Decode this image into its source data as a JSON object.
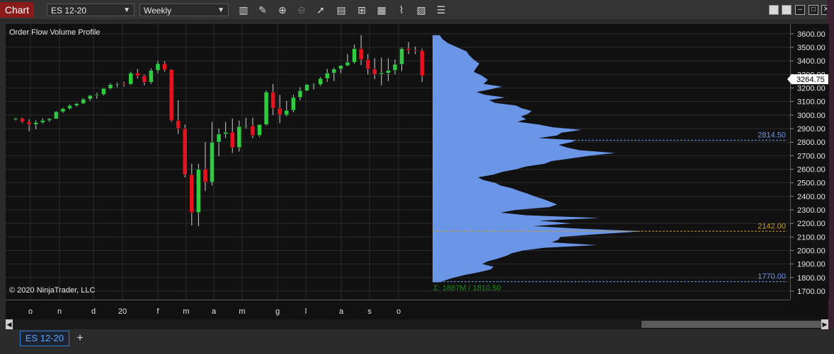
{
  "toolbar": {
    "chart_label": "Chart",
    "instrument": "ES 12-20",
    "interval": "Weekly",
    "icons": [
      "bar-type-icon",
      "drawing-pencil-icon",
      "zoom-in-icon",
      "zoom-out-icon",
      "pointer-icon",
      "data-box-icon",
      "indicators-icon",
      "strategies-icon",
      "templates-icon",
      "properties-icon",
      "more-icon"
    ]
  },
  "panel": {
    "indicator_label": "Order Flow Volume Profile",
    "copyright": "© 2020 NinjaTrader, LLC",
    "profile_summary": "Σ: 1887M / 1810.50"
  },
  "tabs": {
    "active": "ES 12-20",
    "add": "+"
  },
  "colors": {
    "up": "#2ecc40",
    "down": "#e8121f",
    "profile": "#6b96e8",
    "poc": "#c79a2a",
    "value_area": "#6b96e8",
    "current_price_bg": "#ffffff"
  },
  "chart_data": {
    "type": "candlestick",
    "y_range": [
      1650,
      3620
    ],
    "y_ticks": [
      "3600.00",
      "3500.00",
      "3400.00",
      "3300.00",
      "3200.00",
      "3100.00",
      "3000.00",
      "2900.00",
      "2800.00",
      "2700.00",
      "2600.00",
      "2500.00",
      "2400.00",
      "2300.00",
      "2200.00",
      "2100.00",
      "2000.00",
      "1900.00",
      "1800.00",
      "1700.00"
    ],
    "x_labels": [
      "o",
      "n",
      "d",
      "20",
      "f",
      "m",
      "a",
      "m",
      "g",
      "l",
      "a",
      "s",
      "o"
    ],
    "current_price": "3264.75",
    "levels": [
      {
        "name": "value-area-high",
        "label": "2814.50",
        "value": 2814.5
      },
      {
        "name": "poc",
        "label": "2142.00",
        "value": 2142.0
      },
      {
        "name": "value-area-low",
        "label": "1770.00",
        "value": 1770.0
      }
    ],
    "candles": [
      [
        2968,
        2980,
        2960,
        2976
      ],
      [
        2976,
        2982,
        2940,
        2950
      ],
      [
        2950,
        2970,
        2880,
        2930
      ],
      [
        2930,
        2960,
        2895,
        2945
      ],
      [
        2945,
        2975,
        2935,
        2960
      ],
      [
        2960,
        2978,
        2950,
        2972
      ],
      [
        2972,
        3030,
        2970,
        3025
      ],
      [
        3025,
        3055,
        3015,
        3048
      ],
      [
        3048,
        3078,
        3040,
        3070
      ],
      [
        3070,
        3090,
        3060,
        3085
      ],
      [
        3085,
        3125,
        3080,
        3118
      ],
      [
        3118,
        3150,
        3105,
        3145
      ],
      [
        3145,
        3165,
        3120,
        3152
      ],
      [
        3152,
        3200,
        3145,
        3196
      ],
      [
        3196,
        3235,
        3188,
        3225
      ],
      [
        3225,
        3240,
        3205,
        3230
      ],
      [
        3230,
        3245,
        3210,
        3228
      ],
      [
        3228,
        3320,
        3222,
        3310
      ],
      [
        3310,
        3340,
        3270,
        3290
      ],
      [
        3290,
        3300,
        3220,
        3242
      ],
      [
        3242,
        3345,
        3230,
        3330
      ],
      [
        3330,
        3400,
        3310,
        3380
      ],
      [
        3380,
        3398,
        3320,
        3335
      ],
      [
        3335,
        3340,
        2950,
        2960
      ],
      [
        2960,
        3110,
        2860,
        2900
      ],
      [
        2900,
        2930,
        2540,
        2560
      ],
      [
        2560,
        2640,
        2185,
        2280
      ],
      [
        2280,
        2640,
        2180,
        2600
      ],
      [
        2600,
        2800,
        2440,
        2505
      ],
      [
        2505,
        2950,
        2480,
        2800
      ],
      [
        2800,
        2900,
        2695,
        2860
      ],
      [
        2860,
        2950,
        2830,
        2873
      ],
      [
        2873,
        2975,
        2720,
        2760
      ],
      [
        2760,
        2960,
        2730,
        2915
      ],
      [
        2915,
        2980,
        2900,
        2920
      ],
      [
        2920,
        2980,
        2830,
        2850
      ],
      [
        2850,
        2930,
        2840,
        2930
      ],
      [
        2930,
        3180,
        2920,
        3170
      ],
      [
        3170,
        3230,
        3000,
        3050
      ],
      [
        3050,
        3150,
        2940,
        3000
      ],
      [
        3000,
        3105,
        2990,
        3035
      ],
      [
        3035,
        3150,
        3020,
        3130
      ],
      [
        3130,
        3205,
        3110,
        3180
      ],
      [
        3180,
        3230,
        3175,
        3225
      ],
      [
        3225,
        3235,
        3190,
        3226
      ],
      [
        3226,
        3280,
        3215,
        3270
      ],
      [
        3270,
        3340,
        3245,
        3310
      ],
      [
        3310,
        3350,
        3250,
        3340
      ],
      [
        3340,
        3370,
        3310,
        3365
      ],
      [
        3365,
        3450,
        3360,
        3390
      ],
      [
        3390,
        3520,
        3380,
        3490
      ],
      [
        3490,
        3590,
        3370,
        3410
      ],
      [
        3410,
        3450,
        3300,
        3340
      ],
      [
        3340,
        3420,
        3265,
        3300
      ],
      [
        3300,
        3425,
        3220,
        3310
      ],
      [
        3310,
        3420,
        3250,
        3330
      ],
      [
        3330,
        3410,
        3300,
        3375
      ],
      [
        3375,
        3500,
        3325,
        3490
      ],
      [
        3490,
        3540,
        3450,
        3478
      ],
      [
        3478,
        3505,
        3450,
        3475
      ],
      [
        3475,
        3490,
        3245,
        3290
      ]
    ],
    "profile": [
      [
        3590,
        10
      ],
      [
        3560,
        14
      ],
      [
        3530,
        22
      ],
      [
        3500,
        35
      ],
      [
        3470,
        48
      ],
      [
        3440,
        52
      ],
      [
        3410,
        58
      ],
      [
        3380,
        66
      ],
      [
        3350,
        62
      ],
      [
        3320,
        58
      ],
      [
        3290,
        70
      ],
      [
        3260,
        78
      ],
      [
        3230,
        72
      ],
      [
        3210,
        98
      ],
      [
        3190,
        82
      ],
      [
        3170,
        62
      ],
      [
        3150,
        74
      ],
      [
        3130,
        102
      ],
      [
        3110,
        80
      ],
      [
        3090,
        88
      ],
      [
        3070,
        118
      ],
      [
        3050,
        126
      ],
      [
        3030,
        140
      ],
      [
        3010,
        135
      ],
      [
        2990,
        125
      ],
      [
        2970,
        132
      ],
      [
        2950,
        120
      ],
      [
        2930,
        150
      ],
      [
        2910,
        170
      ],
      [
        2890,
        210
      ],
      [
        2870,
        182
      ],
      [
        2850,
        176
      ],
      [
        2830,
        150
      ],
      [
        2815,
        202
      ],
      [
        2800,
        196
      ],
      [
        2780,
        178
      ],
      [
        2760,
        190
      ],
      [
        2740,
        208
      ],
      [
        2720,
        258
      ],
      [
        2700,
        222
      ],
      [
        2680,
        196
      ],
      [
        2660,
        168
      ],
      [
        2640,
        158
      ],
      [
        2620,
        132
      ],
      [
        2600,
        118
      ],
      [
        2580,
        98
      ],
      [
        2560,
        86
      ],
      [
        2540,
        64
      ],
      [
        2520,
        72
      ],
      [
        2500,
        88
      ],
      [
        2480,
        96
      ],
      [
        2460,
        112
      ],
      [
        2440,
        122
      ],
      [
        2420,
        134
      ],
      [
        2400,
        144
      ],
      [
        2380,
        156
      ],
      [
        2360,
        166
      ],
      [
        2340,
        176
      ],
      [
        2320,
        165
      ],
      [
        2300,
        118
      ],
      [
        2280,
        96
      ],
      [
        2260,
        132
      ],
      [
        2240,
        236
      ],
      [
        2220,
        150
      ],
      [
        2200,
        196
      ],
      [
        2180,
        142
      ],
      [
        2160,
        212
      ],
      [
        2142,
        298
      ],
      [
        2120,
        232
      ],
      [
        2100,
        180
      ],
      [
        2080,
        178
      ],
      [
        2060,
        168
      ],
      [
        2040,
        232
      ],
      [
        2020,
        158
      ],
      [
        2000,
        128
      ],
      [
        1980,
        112
      ],
      [
        1960,
        104
      ],
      [
        1940,
        92
      ],
      [
        1920,
        78
      ],
      [
        1900,
        70
      ],
      [
        1880,
        86
      ],
      [
        1860,
        82
      ],
      [
        1840,
        66
      ],
      [
        1820,
        46
      ],
      [
        1800,
        30
      ],
      [
        1780,
        18
      ],
      [
        1765,
        10
      ]
    ]
  }
}
